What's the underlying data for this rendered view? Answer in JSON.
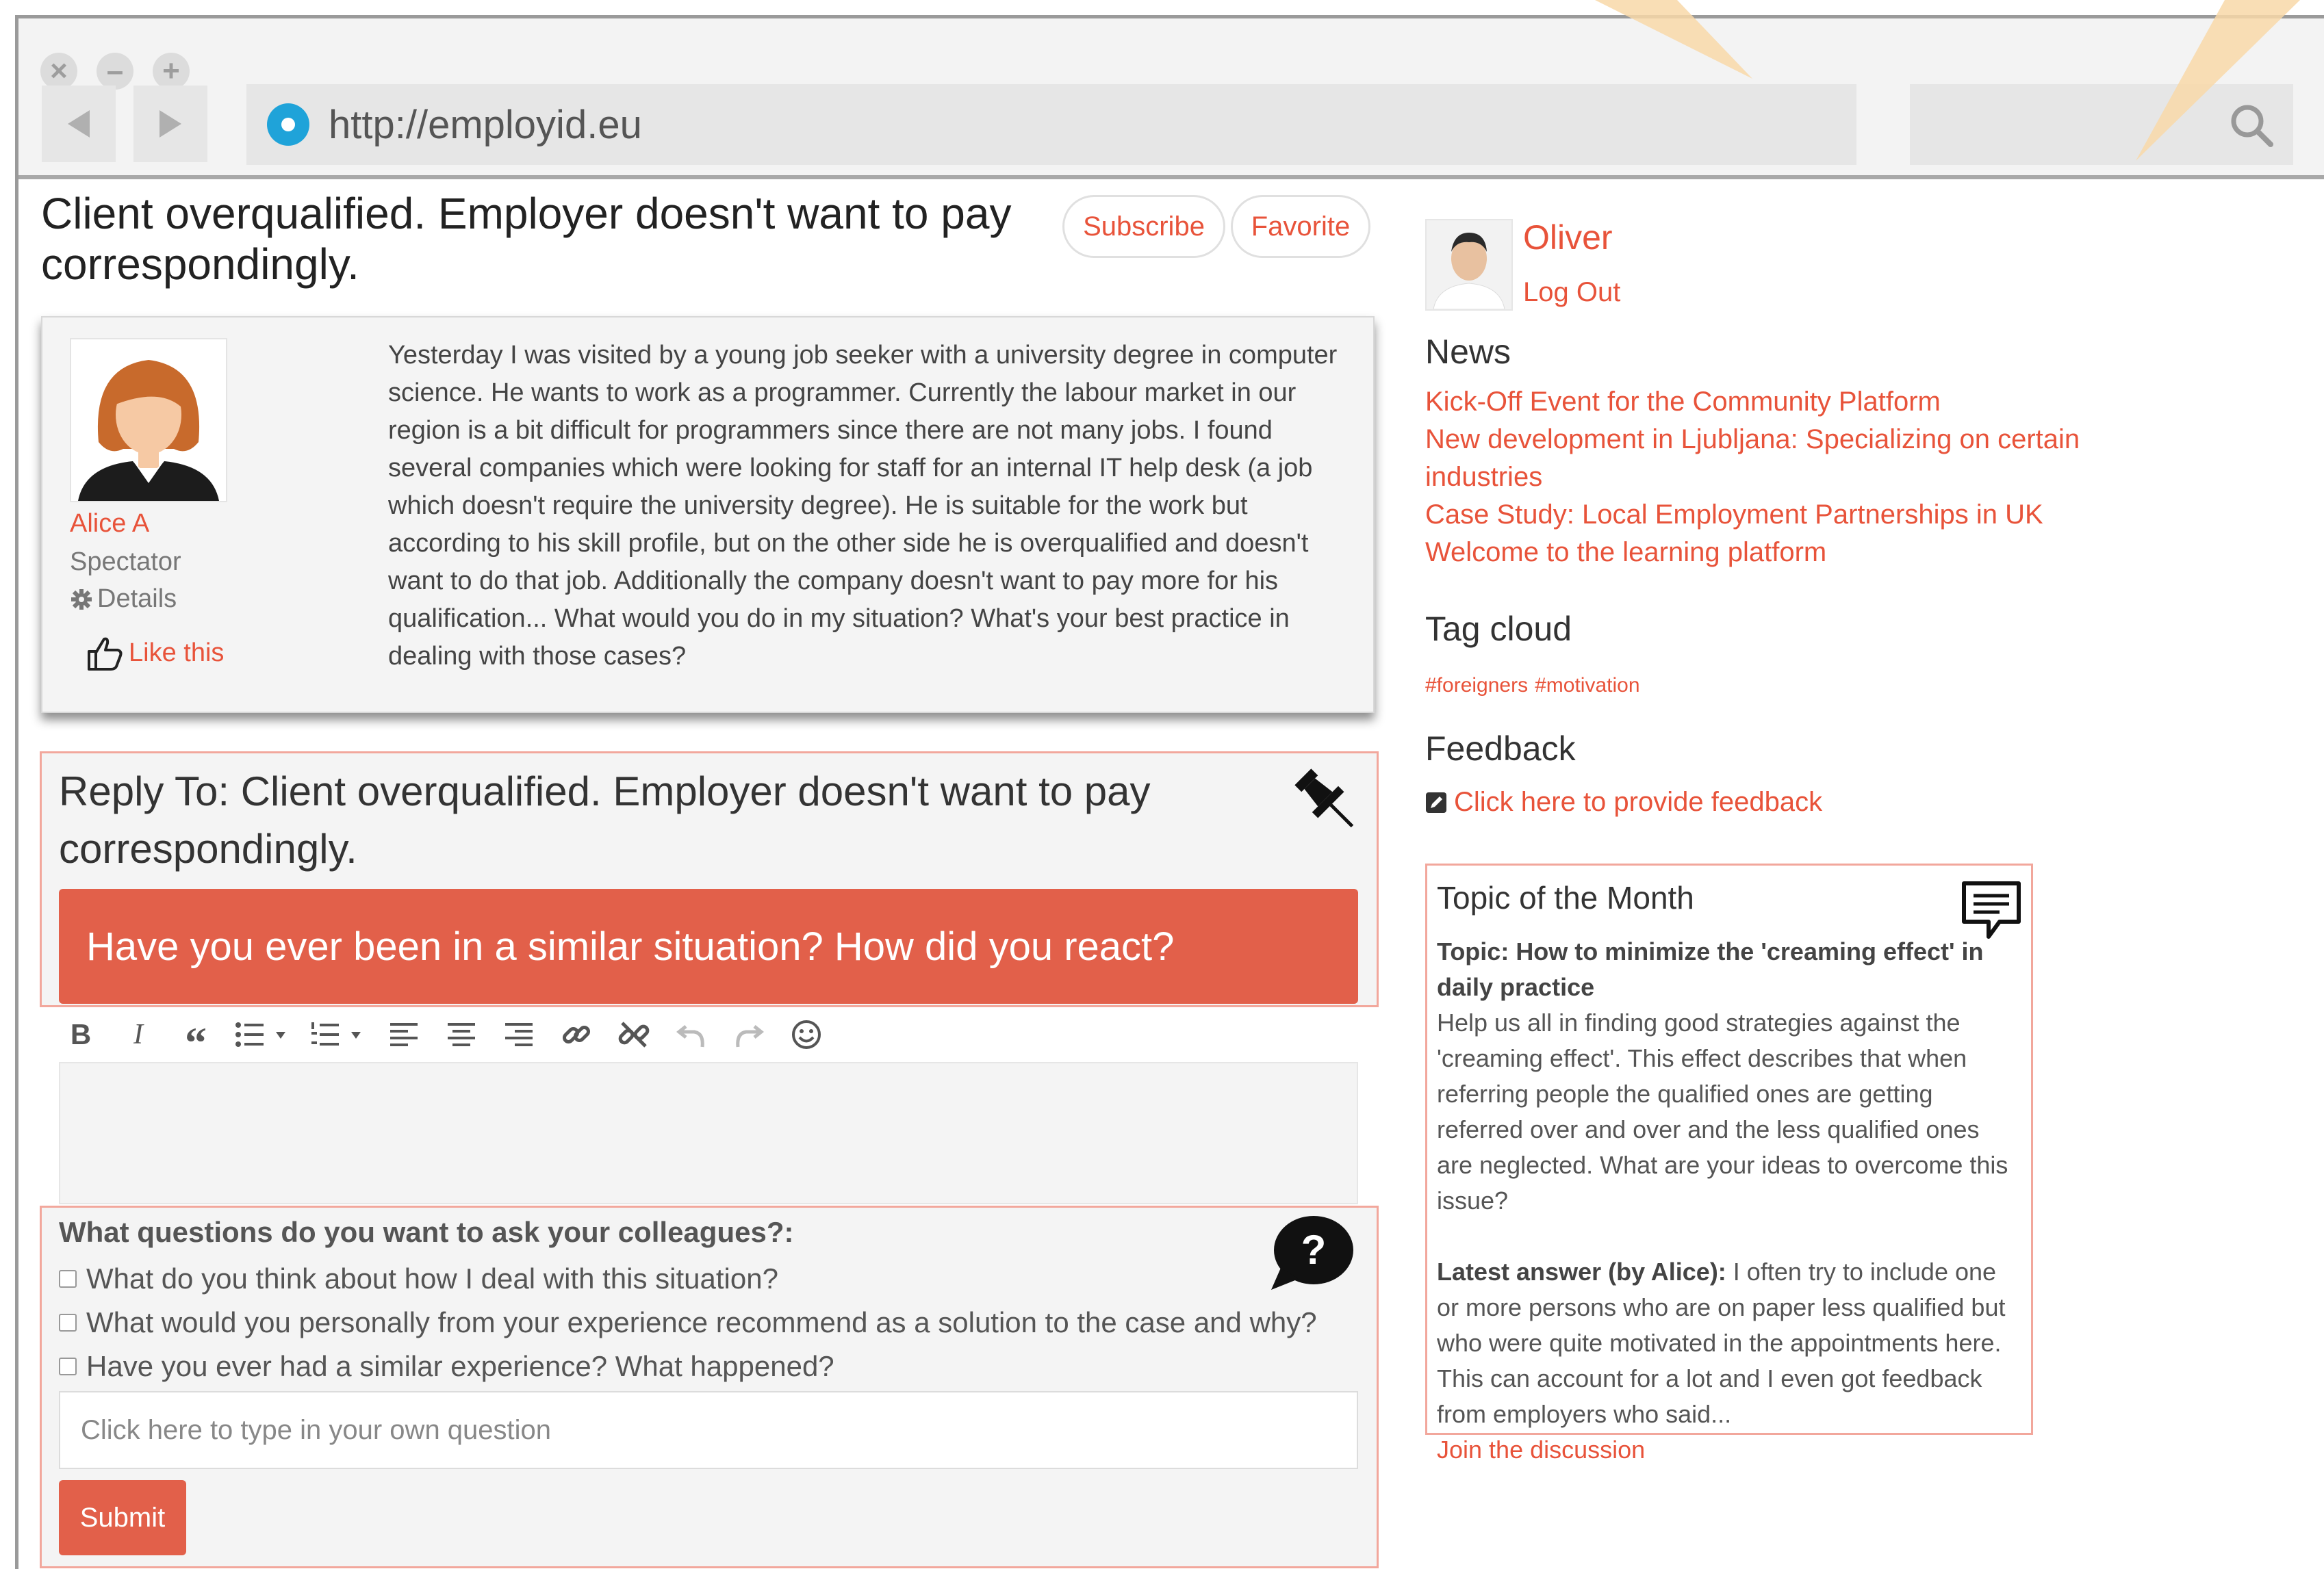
{
  "browser": {
    "url": "http://employid.eu",
    "window_controls": [
      "close-icon",
      "minimize-icon",
      "maximize-icon"
    ]
  },
  "post": {
    "title": "Client overqualified. Employer doesn't want to pay correspondingly.",
    "subscribe_label": "Subscribe",
    "favorite_label": "Favorite",
    "author": {
      "name": "Alice A",
      "role": "Spectator",
      "details_label": "Details",
      "like_label": "Like this"
    },
    "body": "Yesterday I was visited by a young job seeker with a university degree in computer science. He wants to work as a programmer. Currently the labour market in our region is a bit difficult for programmers since there are not many jobs. I found several companies which were looking for staff for an internal IT help desk (a job which doesn't require the university degree). He is suitable for the work but according to his skill profile, but on the other side he is overqualified and doesn't want to do that job. Additionally the company doesn't want to pay more for his qualification... What would you do in my situation? What's your best practice in dealing with those cases?"
  },
  "reply": {
    "title": "Reply To: Client overqualified. Employer doesn't want to pay correspondingly.",
    "prompt": "Have you ever been in a similar situation? How did you react?",
    "toolbar": [
      "bold",
      "italic",
      "blockquote",
      "bullet-list",
      "numbered-list",
      "align-left",
      "align-center",
      "align-right",
      "link",
      "unlink",
      "undo",
      "redo",
      "emoji"
    ],
    "toolbar_labels": {
      "bold": "B",
      "italic": "I",
      "quote": "“"
    }
  },
  "questions": {
    "heading": "What questions do you want to ask your colleagues?:",
    "items": [
      "What do you think about how I deal with this situation?",
      "What would you personally from your experience recommend as a solution to the case and why?",
      "Have you ever had a similar experience? What happened?"
    ],
    "own_placeholder": "Click here to type in your own question",
    "submit_label": "Submit"
  },
  "sidebar": {
    "user_name": "Oliver",
    "logout_label": "Log Out",
    "news_heading": "News",
    "news": [
      "Kick-Off Event for the Community Platform",
      "New development in Ljubljana: Specializing on certain industries",
      "Case Study: Local Employment Partnerships in UK",
      "Welcome to the learning platform"
    ],
    "tag_heading": "Tag cloud",
    "tags": [
      "#foreigners",
      "#motivation"
    ],
    "feedback_heading": "Feedback",
    "feedback_link": "Click here to provide feedback",
    "totm": {
      "title": "Topic of the Month",
      "topic": "Topic: How to minimize the 'creaming effect' in daily practice",
      "description": "Help us all in finding good strategies against the 'creaming effect'. This effect describes that when referring people the qualified ones are getting referred over and over and the less qualified ones are neglected. What are your ideas to overcome this issue?",
      "latest_label": "Latest answer (by Alice):",
      "latest_text": " I often try to include one or more persons who are on paper less qualified but who were quite motivated in the appointments here. This can account for a lot and I even got feedback from employers who said...",
      "join_link": "Join the discussion"
    }
  },
  "colors": {
    "accent": "#e8533a",
    "prompt_bar": "#e2604a",
    "highlight_border": "#f2a79c",
    "panel_bg": "#f4f4f4"
  }
}
